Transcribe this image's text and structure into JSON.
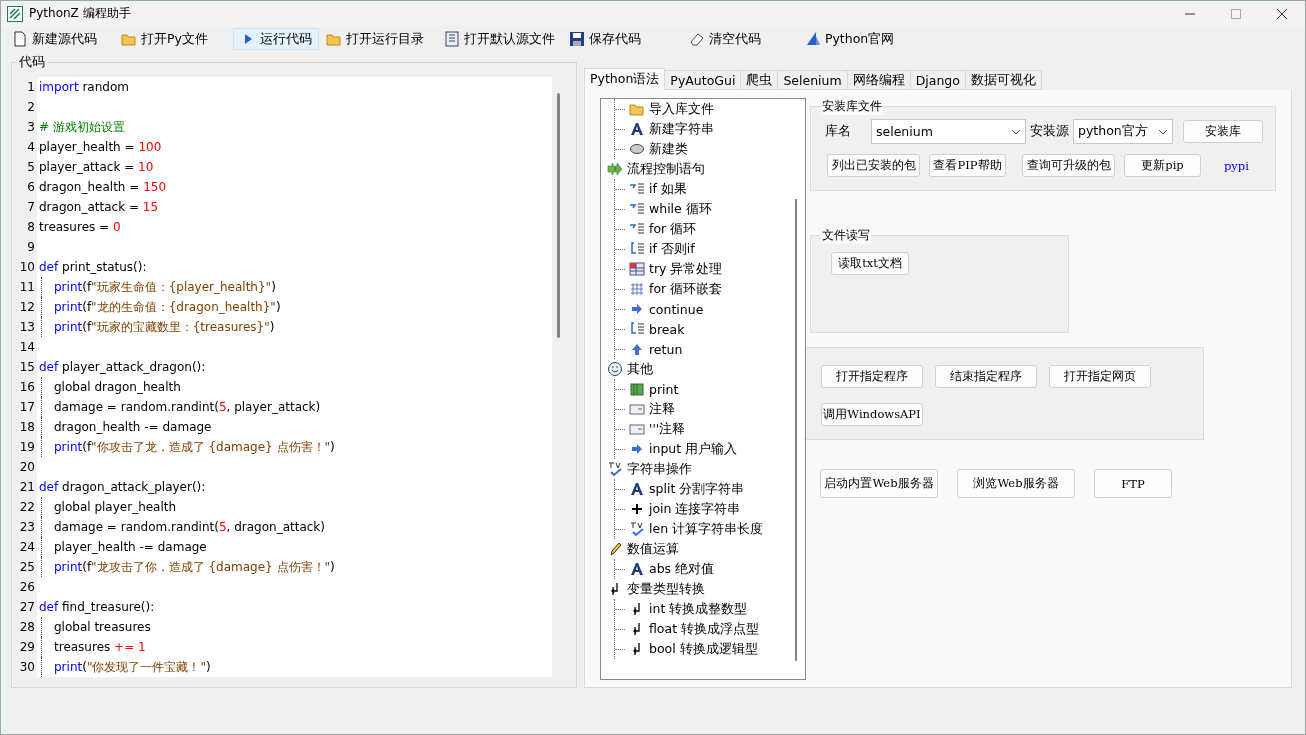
{
  "window": {
    "title": "PythonZ 编程助手"
  },
  "toolbar": [
    {
      "label": "新建源代码",
      "highlighted": false
    },
    {
      "label": "打开Py文件",
      "highlighted": false
    },
    {
      "label": "运行代码",
      "highlighted": true
    },
    {
      "label": "打开运行目录",
      "highlighted": false
    },
    {
      "label": "打开默认源文件",
      "highlighted": false
    },
    {
      "label": "保存代码",
      "highlighted": false
    },
    {
      "label": "清空代码",
      "highlighted": false
    },
    {
      "label": "Python官网",
      "highlighted": false
    }
  ],
  "code_panel": {
    "title": "代码",
    "lines": [
      {
        "num": "1",
        "tokens": [
          {
            "kind": "kw",
            "text": "import"
          },
          {
            "kind": "plain",
            "text": " random"
          }
        ]
      },
      {
        "num": "2"
      },
      {
        "num": "3",
        "tokens": [
          {
            "kind": "com",
            "text": "# 游戏初始设置"
          }
        ]
      },
      {
        "num": "4",
        "tokens": [
          {
            "kind": "plain",
            "text": "player_health = "
          },
          {
            "kind": "num",
            "text": "100"
          }
        ]
      },
      {
        "num": "5",
        "tokens": [
          {
            "kind": "plain",
            "text": "player_attack = "
          },
          {
            "kind": "num",
            "text": "10"
          }
        ]
      },
      {
        "num": "6",
        "tokens": [
          {
            "kind": "plain",
            "text": "dragon_health = "
          },
          {
            "kind": "num",
            "text": "150"
          }
        ]
      },
      {
        "num": "7",
        "tokens": [
          {
            "kind": "plain",
            "text": "dragon_attack = "
          },
          {
            "kind": "num",
            "text": "15"
          }
        ]
      },
      {
        "num": "8",
        "tokens": [
          {
            "kind": "plain",
            "text": "treasures = "
          },
          {
            "kind": "num",
            "text": "0"
          }
        ]
      },
      {
        "num": "9"
      },
      {
        "num": "10",
        "tokens": [
          {
            "kind": "kw",
            "text": "def"
          },
          {
            "kind": "plain",
            "text": " print_status():"
          }
        ]
      },
      {
        "num": "11",
        "indented": true,
        "tokens": [
          {
            "kind": "kw",
            "text": "print"
          },
          {
            "kind": "plain",
            "text": "(f"
          },
          {
            "kind": "str",
            "text": "\"玩家生命值：{player_health}\""
          },
          {
            "kind": "plain",
            "text": ")"
          }
        ]
      },
      {
        "num": "12",
        "indented": true,
        "tokens": [
          {
            "kind": "kw",
            "text": "print"
          },
          {
            "kind": "plain",
            "text": "(f"
          },
          {
            "kind": "str",
            "text": "\"龙的生命值：{dragon_health}\""
          },
          {
            "kind": "plain",
            "text": ")"
          }
        ]
      },
      {
        "num": "13",
        "indented": true,
        "tokens": [
          {
            "kind": "kw",
            "text": "print"
          },
          {
            "kind": "plain",
            "text": "(f"
          },
          {
            "kind": "str",
            "text": "\"玩家的宝藏数里：{treasures}\""
          },
          {
            "kind": "plain",
            "text": ")"
          }
        ]
      },
      {
        "num": "14"
      },
      {
        "num": "15",
        "tokens": [
          {
            "kind": "kw",
            "text": "def"
          },
          {
            "kind": "plain",
            "text": " player_attack_dragon():"
          }
        ]
      },
      {
        "num": "16",
        "indented": true,
        "tokens": [
          {
            "kind": "plain",
            "text": "global dragon_health"
          }
        ]
      },
      {
        "num": "17",
        "indented": true,
        "tokens": [
          {
            "kind": "plain",
            "text": "damage = random.randint("
          },
          {
            "kind": "num",
            "text": "5"
          },
          {
            "kind": "plain",
            "text": ", player_attack)"
          }
        ]
      },
      {
        "num": "18",
        "indented": true,
        "tokens": [
          {
            "kind": "plain",
            "text": "dragon_health -= damage"
          }
        ]
      },
      {
        "num": "19",
        "indented": true,
        "tokens": [
          {
            "kind": "kw",
            "text": "print"
          },
          {
            "kind": "plain",
            "text": "(f"
          },
          {
            "kind": "str",
            "text": "\"你攻击了龙，造成了 {damage} 点伤害！\""
          },
          {
            "kind": "plain",
            "text": ")"
          }
        ]
      },
      {
        "num": "20"
      },
      {
        "num": "21",
        "tokens": [
          {
            "kind": "kw",
            "text": "def"
          },
          {
            "kind": "plain",
            "text": " dragon_attack_player():"
          }
        ]
      },
      {
        "num": "22",
        "indented": true,
        "tokens": [
          {
            "kind": "plain",
            "text": "global player_health"
          }
        ]
      },
      {
        "num": "23",
        "indented": true,
        "tokens": [
          {
            "kind": "plain",
            "text": "damage = random.randint("
          },
          {
            "kind": "num",
            "text": "5"
          },
          {
            "kind": "plain",
            "text": ", dragon_attack)"
          }
        ]
      },
      {
        "num": "24",
        "indented": true,
        "tokens": [
          {
            "kind": "plain",
            "text": "player_health -= damage"
          }
        ]
      },
      {
        "num": "25",
        "indented": true,
        "tokens": [
          {
            "kind": "kw",
            "text": "print"
          },
          {
            "kind": "plain",
            "text": "(f"
          },
          {
            "kind": "str",
            "text": "\"龙攻击了你，造成了 {damage} 点伤害！\""
          },
          {
            "kind": "plain",
            "text": ")"
          }
        ]
      },
      {
        "num": "26"
      },
      {
        "num": "27",
        "tokens": [
          {
            "kind": "kw",
            "text": "def"
          },
          {
            "kind": "plain",
            "text": " find_treasure():"
          }
        ]
      },
      {
        "num": "28",
        "indented": true,
        "tokens": [
          {
            "kind": "plain",
            "text": "global treasures"
          }
        ]
      },
      {
        "num": "29",
        "indented": true,
        "tokens": [
          {
            "kind": "plain",
            "text": "treasures "
          },
          {
            "kind": "num",
            "text": "+= 1"
          }
        ]
      },
      {
        "num": "30",
        "indented": true,
        "tokens": [
          {
            "kind": "kw",
            "text": "print"
          },
          {
            "kind": "plain",
            "text": "("
          },
          {
            "kind": "str",
            "text": "\"你发现了一件宝藏！\""
          },
          {
            "kind": "plain",
            "text": ")"
          }
        ]
      }
    ]
  },
  "tabs": [
    {
      "label": "Python语法",
      "selected": true
    },
    {
      "label": "PyAutoGui",
      "selected": false
    },
    {
      "label": "爬虫",
      "selected": false
    },
    {
      "label": "Selenium",
      "selected": false
    },
    {
      "label": "网络编程",
      "selected": false
    },
    {
      "label": "Django",
      "selected": false
    },
    {
      "label": "数据可视化",
      "selected": false
    }
  ],
  "tree": [
    {
      "children": [
        {
          "label": "导入库文件"
        },
        {
          "label": "新建字符串"
        },
        {
          "label": "新建类"
        }
      ]
    },
    {
      "label": "流程控制语句",
      "children": [
        {
          "label": "if 如果"
        },
        {
          "label": "while 循环"
        },
        {
          "label": "for 循环"
        },
        {
          "label": "if 否则if"
        },
        {
          "label": "try 异常处理"
        },
        {
          "label": "for 循环嵌套"
        },
        {
          "label": "continue"
        },
        {
          "label": "break"
        },
        {
          "label": "retun"
        }
      ]
    },
    {
      "label": "其他",
      "children": [
        {
          "label": "print"
        },
        {
          "label": "注释"
        },
        {
          "label": "'''注释"
        },
        {
          "label": "input 用户输入"
        }
      ]
    },
    {
      "label": "字符串操作",
      "children": [
        {
          "label": "split 分割字符串"
        },
        {
          "label": "join 连接字符串"
        },
        {
          "label": "len 计算字符串长度"
        }
      ]
    },
    {
      "label": "数值运算",
      "children": [
        {
          "label": "abs 绝对值"
        }
      ]
    },
    {
      "label": "变量类型转换",
      "children": [
        {
          "label": "int 转换成整数型"
        },
        {
          "label": "float 转换成浮点型"
        },
        {
          "label": "bool 转换成逻辑型"
        }
      ]
    }
  ],
  "install_group": {
    "title": "安装库文件",
    "library_label": "库名",
    "library_value": "selenium",
    "source_label": "安装源",
    "source_value": "python官方",
    "install_button": "安装库",
    "buttons": [
      "列出已安装的包",
      "查看PIP帮助",
      "查询可升级的包",
      "更新pip"
    ],
    "link": "pypi"
  },
  "file_group": {
    "title": "文件读写",
    "buttons": [
      "读取txt文档"
    ]
  },
  "program_group": {
    "buttons": [
      "打开指定程序",
      "结束指定程序",
      "打开指定网页",
      "调用WindowsAPI"
    ]
  },
  "server_buttons": [
    "启动内置Web服务器",
    "浏览Web服务器",
    "FTP"
  ]
}
